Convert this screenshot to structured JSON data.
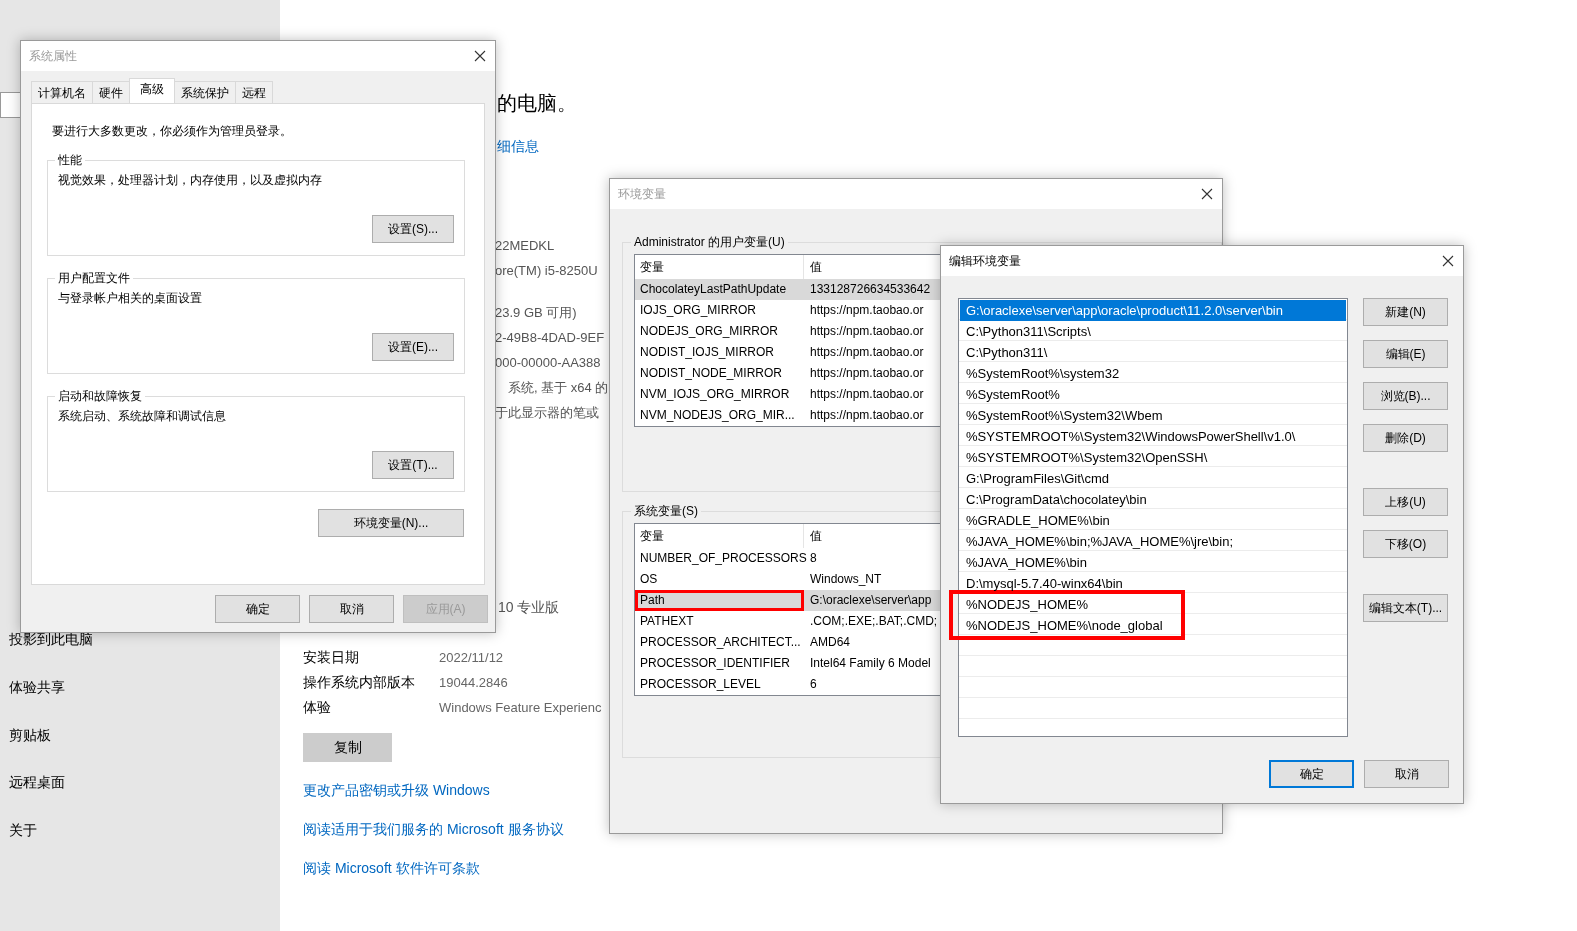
{
  "settings_window": {
    "sidebar": {
      "items": [
        {
          "label": "投影到此电脑"
        },
        {
          "label": "体验共享"
        },
        {
          "label": "剪贴板"
        },
        {
          "label": "远程桌面"
        },
        {
          "label": "关于"
        }
      ]
    },
    "content": {
      "heading": "的电脑。",
      "details_link": "细信息",
      "specs": [
        "22MEDKL",
        "ore(TM) i5-8250U",
        "23.9 GB 可用)",
        "2-49B8-4DAD-9EF",
        "000-00000-AA388",
        "系统, 基于 x64 的",
        "于此显示器的笔或"
      ],
      "edition": "10 专业版",
      "rows": [
        {
          "label": "安装日期",
          "value": "2022/11/12"
        },
        {
          "label": "操作系统内部版本",
          "value": "19044.2846"
        },
        {
          "label": "体验",
          "value": "Windows Feature Experienc"
        }
      ],
      "copy_button": "复制",
      "links": [
        "更改产品密钥或升级 Windows",
        "阅读适用于我们服务的 Microsoft 服务协议",
        "阅读 Microsoft 软件许可条款"
      ]
    }
  },
  "system_properties": {
    "title": "系统属性",
    "active": false,
    "tabs": [
      {
        "label": "计算机名",
        "selected": false
      },
      {
        "label": "硬件",
        "selected": false
      },
      {
        "label": "高级",
        "selected": true
      },
      {
        "label": "系统保护",
        "selected": false
      },
      {
        "label": "远程",
        "selected": false
      }
    ],
    "admin_note": "要进行大多数更改，你必须作为管理员登录。",
    "groups": [
      {
        "title": "性能",
        "description": "视觉效果，处理器计划，内存使用，以及虚拟内存",
        "button": "设置(S)..."
      },
      {
        "title": "用户配置文件",
        "description": "与登录帐户相关的桌面设置",
        "button": "设置(E)..."
      },
      {
        "title": "启动和故障恢复",
        "description": "系统启动、系统故障和调试信息",
        "button": "设置(T)..."
      }
    ],
    "env_button": "环境变量(N)...",
    "buttons": [
      {
        "label": "确定",
        "disabled": false
      },
      {
        "label": "取消",
        "disabled": false
      },
      {
        "label": "应用(A)",
        "disabled": true
      }
    ]
  },
  "environment_variables": {
    "title": "环境变量",
    "active": false,
    "user_group": {
      "title": "Administrator 的用户变量(U)",
      "columns": [
        "变量",
        "值"
      ],
      "rows": [
        {
          "name": "ChocolateyLastPathUpdate",
          "value": "133128726634533642",
          "selected": true,
          "highlighted": false
        },
        {
          "name": "IOJS_ORG_MIRROR",
          "value": "https://npm.taobao.or",
          "selected": false,
          "highlighted": false
        },
        {
          "name": "NODEJS_ORG_MIRROR",
          "value": "https://npm.taobao.or",
          "selected": false,
          "highlighted": false
        },
        {
          "name": "NODIST_IOJS_MIRROR",
          "value": "https://npm.taobao.or",
          "selected": false,
          "highlighted": false
        },
        {
          "name": "NODIST_NODE_MIRROR",
          "value": "https://npm.taobao.or",
          "selected": false,
          "highlighted": false
        },
        {
          "name": "NVM_IOJS_ORG_MIRROR",
          "value": "https://npm.taobao.or",
          "selected": false,
          "highlighted": false
        },
        {
          "name": "NVM_NODEJS_ORG_MIR...",
          "value": "https://npm.taobao.or",
          "selected": false,
          "highlighted": false
        }
      ]
    },
    "system_group": {
      "title": "系统变量(S)",
      "columns": [
        "变量",
        "值"
      ],
      "rows": [
        {
          "name": "NUMBER_OF_PROCESSORS",
          "value": "8",
          "selected": false,
          "highlighted": false
        },
        {
          "name": "OS",
          "value": "Windows_NT",
          "selected": false,
          "highlighted": false
        },
        {
          "name": "Path",
          "value": "G:\\oraclexe\\server\\app",
          "selected": true,
          "highlighted": true
        },
        {
          "name": "PATHEXT",
          "value": ".COM;.EXE;.BAT;.CMD;",
          "selected": false,
          "highlighted": false
        },
        {
          "name": "PROCESSOR_ARCHITECT...",
          "value": "AMD64",
          "selected": false,
          "highlighted": false
        },
        {
          "name": "PROCESSOR_IDENTIFIER",
          "value": "Intel64 Family 6 Model",
          "selected": false,
          "highlighted": false
        },
        {
          "name": "PROCESSOR_LEVEL",
          "value": "6",
          "selected": false,
          "highlighted": false
        }
      ]
    }
  },
  "edit_environment_variable": {
    "title": "编辑环境变量",
    "active": true,
    "entries": [
      {
        "text": "G:\\oraclexe\\server\\app\\oracle\\product\\11.2.0\\server\\bin",
        "selected": true,
        "highlighted": false
      },
      {
        "text": "C:\\Python311\\Scripts\\",
        "selected": false,
        "highlighted": false
      },
      {
        "text": "C:\\Python311\\",
        "selected": false,
        "highlighted": false
      },
      {
        "text": "%SystemRoot%\\system32",
        "selected": false,
        "highlighted": false
      },
      {
        "text": "%SystemRoot%",
        "selected": false,
        "highlighted": false
      },
      {
        "text": "%SystemRoot%\\System32\\Wbem",
        "selected": false,
        "highlighted": false
      },
      {
        "text": "%SYSTEMROOT%\\System32\\WindowsPowerShell\\v1.0\\",
        "selected": false,
        "highlighted": false
      },
      {
        "text": "%SYSTEMROOT%\\System32\\OpenSSH\\",
        "selected": false,
        "highlighted": false
      },
      {
        "text": "G:\\ProgramFiles\\Git\\cmd",
        "selected": false,
        "highlighted": false
      },
      {
        "text": "C:\\ProgramData\\chocolatey\\bin",
        "selected": false,
        "highlighted": false
      },
      {
        "text": "%GRADLE_HOME%\\bin",
        "selected": false,
        "highlighted": false
      },
      {
        "text": "%JAVA_HOME%\\bin;%JAVA_HOME%\\jre\\bin;",
        "selected": false,
        "highlighted": false
      },
      {
        "text": "%JAVA_HOME%\\bin",
        "selected": false,
        "highlighted": false
      },
      {
        "text": "D:\\mysql-5.7.40-winx64\\bin",
        "selected": false,
        "highlighted": false
      },
      {
        "text": "%NODEJS_HOME%",
        "selected": false,
        "highlighted": true
      },
      {
        "text": "%NODEJS_HOME%\\node_global",
        "selected": false,
        "highlighted": true
      }
    ],
    "side_buttons": [
      {
        "label": "新建(N)",
        "kind": "button"
      },
      {
        "label": "编辑(E)",
        "kind": "button"
      },
      {
        "label": "浏览(B)...",
        "kind": "button"
      },
      {
        "label": "删除(D)",
        "kind": "button"
      },
      {
        "label": "上移(U)",
        "kind": "spaced"
      },
      {
        "label": "下移(O)",
        "kind": "button"
      },
      {
        "label": "编辑文本(T)...",
        "kind": "spaced"
      }
    ],
    "footer_buttons": [
      {
        "label": "确定",
        "default": true
      },
      {
        "label": "取消",
        "default": false
      }
    ]
  }
}
